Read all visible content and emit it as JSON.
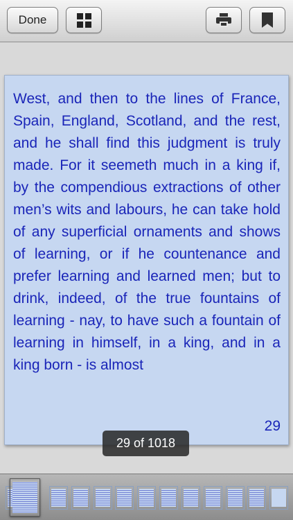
{
  "toolbar": {
    "done_label": "Done",
    "grid_icon": "grid-icon",
    "print_icon": "printer-icon",
    "bookmark_icon": "bookmark-icon"
  },
  "page": {
    "text": "West, and then to the lines of France, Spain, England, Scotland, and the rest, and he shall find this judgment is truly made. For it seemeth much in a king if, by the compendious extractions of other men’s wits and labours, he can take hold of any superficial ornaments and shows of learning, or if he countenance and prefer learning and learned men; but to drink, indeed, of the true fountains of learning - nay, to have such a fountain of learning in himself, in a king, and in a king born - is almost",
    "number": "29"
  },
  "indicator": {
    "label": "29 of 1018"
  },
  "colors": {
    "text": "#1a25b8",
    "page_background": "#c6d7f1"
  }
}
